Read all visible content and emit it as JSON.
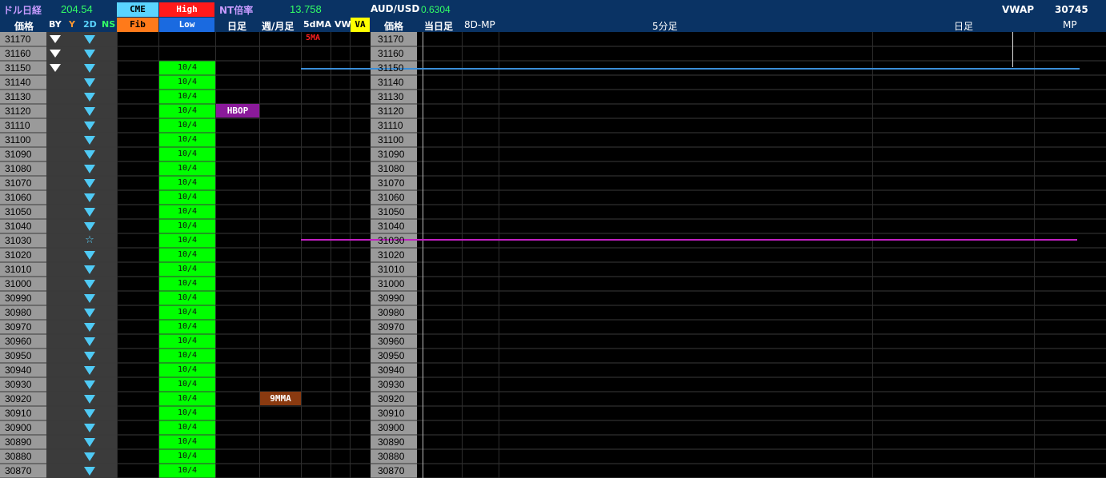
{
  "header": {
    "dollar_nikkei_label": "ドル日経",
    "dollar_nikkei_value": "204.54",
    "cme_label": "CME",
    "high_label": "High",
    "fib_label": "Fib",
    "low_label": "Low",
    "nt_ratio_label": "NT倍率",
    "nt_ratio_value": "13.758",
    "audusd_label": "AUD/USD",
    "audusd_value": "0.6304",
    "vwap_label": "VWAP",
    "vwap_value": "30745"
  },
  "columns": {
    "price_left": "価格",
    "by": "BY",
    "y": "Y",
    "d2": "2D",
    "ns": "NS",
    "daily": "日足",
    "weekly_monthly": "週/月足",
    "ma5d": "5dMA",
    "vw": "VW",
    "va": "VA",
    "price_right": "価格",
    "today": "当日足",
    "mp8d": "8D-MP",
    "min5": "5分足",
    "daily_right": "日足",
    "mp": "MP"
  },
  "prices": [
    "31170",
    "31160",
    "31150",
    "31140",
    "31130",
    "31120",
    "31110",
    "31100",
    "31090",
    "31080",
    "31070",
    "31060",
    "31050",
    "31040",
    "31030",
    "31020",
    "31010",
    "31000",
    "30990",
    "30980",
    "30970",
    "30960",
    "30950",
    "30940",
    "30930",
    "30920",
    "30910",
    "30900",
    "30890",
    "30880",
    "30870"
  ],
  "green_date_label": "10/4",
  "markers": {
    "ma5_label": "5MA",
    "hbop_label": "HBOP",
    "mma9_label": "9MMA",
    "star_glyph": "☆"
  },
  "colors": {
    "header_bg": "#0a3364",
    "green_value": "#33ff66",
    "cme_bg": "#5ad4ff",
    "high_bg": "#ff1a1a",
    "fib_bg": "#ff7a1a",
    "low_bg": "#1a6ae0",
    "va_bg": "#ffff00",
    "blue_line": "#3a8ed8",
    "purple_line": "#c020c0",
    "hbop_bg": "#8a1a9a",
    "mma9_bg": "#8a3a10"
  }
}
